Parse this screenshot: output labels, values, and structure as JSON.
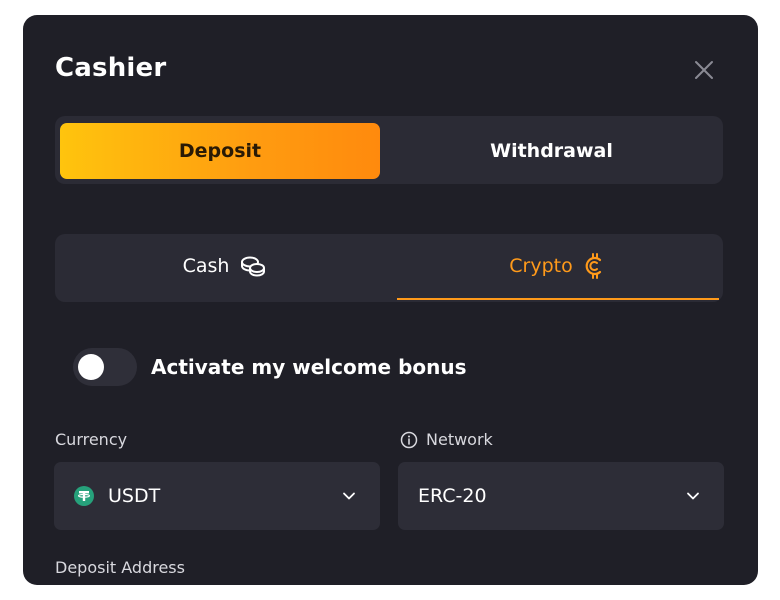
{
  "modal": {
    "title": "Cashier"
  },
  "main_tabs": [
    {
      "label": "Deposit",
      "active": true
    },
    {
      "label": "Withdrawal",
      "active": false
    }
  ],
  "method_tabs": [
    {
      "label": "Cash",
      "icon": "coins-icon",
      "active": false
    },
    {
      "label": "Crypto",
      "icon": "crypto-coin-icon",
      "active": true
    }
  ],
  "bonus": {
    "label": "Activate my welcome bonus",
    "enabled": false
  },
  "currency": {
    "label": "Currency",
    "value": "USDT",
    "icon": "tether-icon"
  },
  "network": {
    "label": "Network",
    "value": "ERC-20",
    "icon": "info-icon"
  },
  "deposit_address": {
    "label": "Deposit Address"
  },
  "colors": {
    "accent": "#ff9a1a",
    "background": "#1f1f27",
    "panel": "#2b2b35",
    "tether": "#26a17b"
  }
}
